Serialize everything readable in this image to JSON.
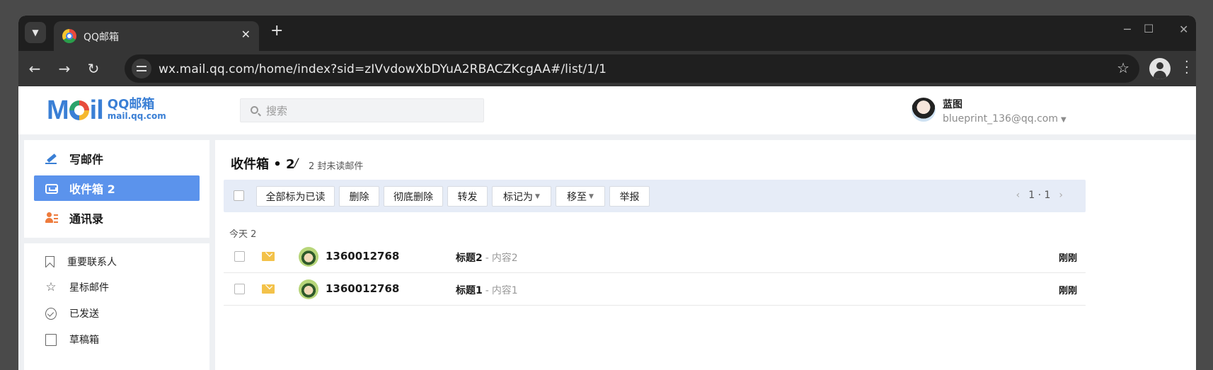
{
  "browser": {
    "tab_title": "QQ邮箱",
    "close_glyph": "✕",
    "new_tab_glyph": "+",
    "url": "wx.mail.qq.com/home/index?sid=zIVvdowXbDYuA2RBACZKcgAA#/list/1/1",
    "window_controls": [
      "─",
      "☐",
      "✕"
    ]
  },
  "header": {
    "logo_mark": "MAIL",
    "logo_cn": "QQ邮箱",
    "logo_domain": "mail.qq.com",
    "search_placeholder": "搜索",
    "user_name": "蓝图",
    "user_email": "blueprint_136@qq.com"
  },
  "sidebar": {
    "primary": [
      {
        "label": "写邮件",
        "icon": "pencil-icon"
      },
      {
        "label": "收件箱 2",
        "icon": "inbox-icon",
        "active": true
      },
      {
        "label": "通讯录",
        "icon": "contacts-icon"
      }
    ],
    "folders": [
      {
        "label": "重要联系人",
        "icon": "bookmark-icon"
      },
      {
        "label": "星标邮件",
        "icon": "star-icon"
      },
      {
        "label": "已发送",
        "icon": "check-circle-icon"
      },
      {
        "label": "草稿箱",
        "icon": "draft-icon"
      }
    ]
  },
  "main": {
    "title": "收件箱 • 2",
    "slash": "/",
    "unread": "2 封未读邮件",
    "actions": {
      "mark_all_read": "全部标为已读",
      "delete": "删除",
      "delete_forever": "彻底删除",
      "forward": "转发",
      "mark_as": "标记为",
      "move_to": "移至",
      "report": "举报"
    },
    "pager": "1 · 1",
    "day_label": "今天 2",
    "mails": [
      {
        "sender": "1360012768",
        "subject": "标题2",
        "preview": "内容2",
        "time": "刚刚"
      },
      {
        "sender": "1360012768",
        "subject": "标题1",
        "preview": "内容1",
        "time": "刚刚"
      }
    ]
  },
  "colors": {
    "accent": "#5b93ec",
    "brand": "#3a7fd5",
    "action_bar": "#e6ecf7",
    "unread_icon": "#f3c24a"
  }
}
